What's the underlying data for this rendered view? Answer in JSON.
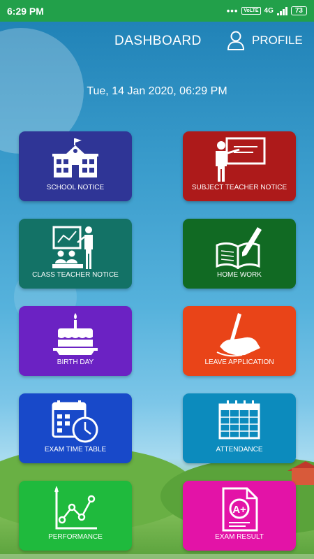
{
  "status_bar": {
    "time": "6:29 PM",
    "dots": "•••",
    "volte": "VoLTE",
    "network": "4G",
    "battery": "73"
  },
  "header": {
    "title": "DASHBOARD",
    "profile_label": "PROFILE"
  },
  "datetime": "Tue, 14 Jan 2020, 06:29 PM",
  "tiles": [
    {
      "label": "SCHOOL NOTICE",
      "color": "#2f3596",
      "icon": "school-building-icon"
    },
    {
      "label": "SUBJECT TEACHER NOTICE",
      "color": "#ad1a1a",
      "icon": "teacher-board-icon"
    },
    {
      "label": "CLASS TEACHER NOTICE",
      "color": "#137266",
      "icon": "classroom-presentation-icon"
    },
    {
      "label": "HOME WORK",
      "color": "#116a23",
      "icon": "book-pencil-icon"
    },
    {
      "label": "BIRTH DAY",
      "color": "#6b22c3",
      "icon": "birthday-cake-icon"
    },
    {
      "label": "LEAVE APPLICATION",
      "color": "#e94418",
      "icon": "hand-writing-icon"
    },
    {
      "label": "EXAM TIME TABLE",
      "color": "#1849c9",
      "icon": "calendar-clock-icon"
    },
    {
      "label": "ATTENDANCE",
      "color": "#0c8bbd",
      "icon": "calendar-icon"
    },
    {
      "label": "PERFORMANCE",
      "color": "#1fba3d",
      "icon": "line-graph-icon"
    },
    {
      "label": "EXAM RESULT",
      "color": "#e313a7",
      "icon": "grade-paper-icon"
    }
  ]
}
